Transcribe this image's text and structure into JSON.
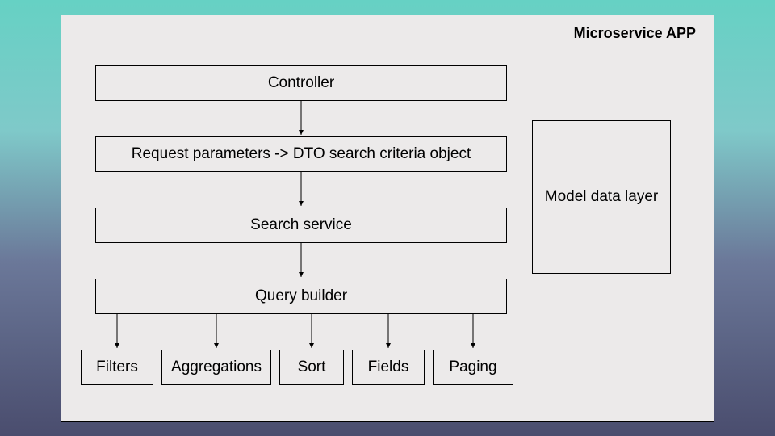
{
  "title": "Microservice APP",
  "boxes": {
    "controller": "Controller",
    "dto": "Request parameters -> DTO search criteria object",
    "search": "Search service",
    "query": "Query builder",
    "filters": "Filters",
    "aggregations": "Aggregations",
    "sort": "Sort",
    "fields": "Fields",
    "paging": "Paging",
    "model": "Model data layer"
  }
}
